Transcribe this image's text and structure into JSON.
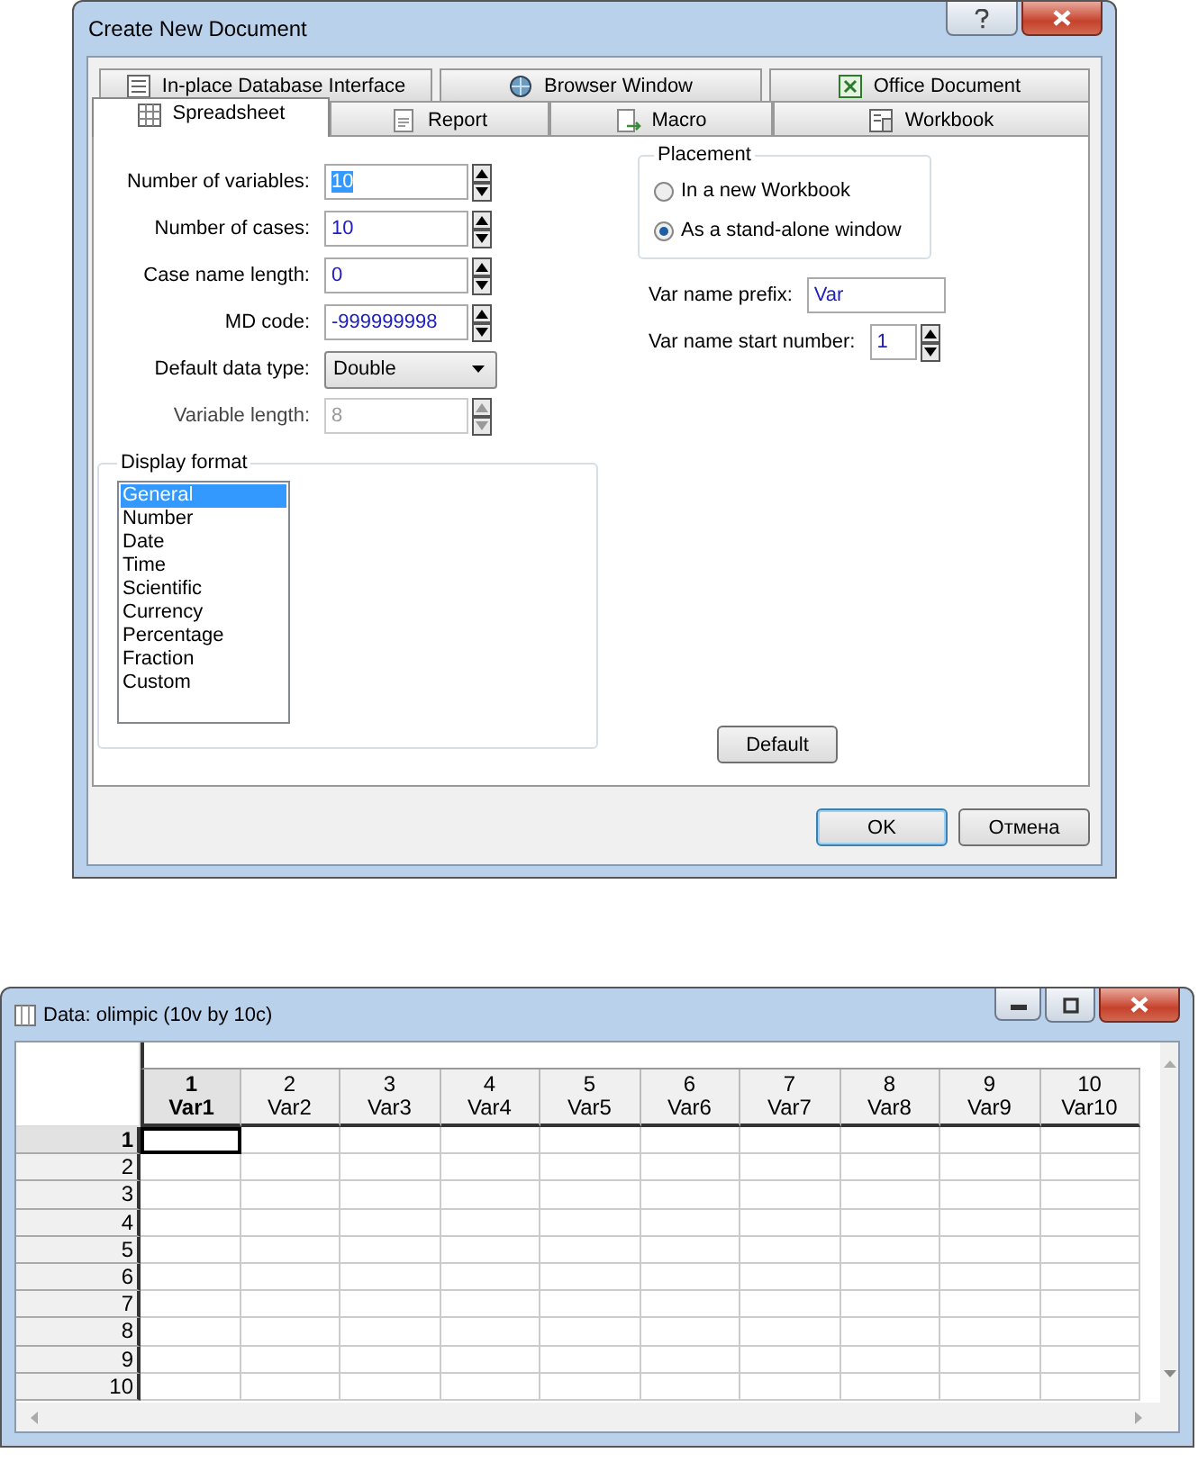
{
  "dialog": {
    "title": "Create New Document",
    "tabs_row_1": [
      {
        "label": "In-place Database Interface",
        "selected": false
      },
      {
        "label": "Browser Window",
        "selected": false
      },
      {
        "label": "Office Document",
        "selected": false
      }
    ],
    "tabs_row_2": [
      {
        "label": "Spreadsheet",
        "selected": true
      },
      {
        "label": "Report",
        "selected": false
      },
      {
        "label": "Macro",
        "selected": false
      },
      {
        "label": "Workbook",
        "selected": false
      }
    ],
    "fields": [
      {
        "kind": "spin",
        "label": "Number of variables:",
        "value": "10",
        "text_selected": true,
        "disabled": false
      },
      {
        "kind": "spin",
        "label": "Number of cases:",
        "value": "10",
        "text_selected": false,
        "disabled": false
      },
      {
        "kind": "spin",
        "label": "Case name length:",
        "value": "0",
        "text_selected": false,
        "disabled": false
      },
      {
        "kind": "spin",
        "label": "MD code:",
        "value": "-999999998",
        "text_selected": false,
        "disabled": false
      },
      {
        "kind": "dropdown",
        "label": "Default data type:",
        "value": "Double",
        "text_selected": false,
        "disabled": false
      },
      {
        "kind": "spin",
        "label": "Variable length:",
        "value": "8",
        "text_selected": false,
        "disabled": true
      }
    ],
    "placement": {
      "title": "Placement",
      "options": [
        {
          "label": "In a new Workbook",
          "selected": false
        },
        {
          "label": "As a stand-alone window",
          "selected": true
        }
      ]
    },
    "var_name_prefix": {
      "label": "Var name prefix:",
      "value": "Var"
    },
    "var_name_start_number": {
      "label": "Var name start number:",
      "value": "1"
    },
    "display_format": {
      "title": "Display format",
      "items": [
        {
          "label": "General",
          "selected": true
        },
        {
          "label": "Number",
          "selected": false
        },
        {
          "label": "Date",
          "selected": false
        },
        {
          "label": "Time",
          "selected": false
        },
        {
          "label": "Scientific",
          "selected": false
        },
        {
          "label": "Currency",
          "selected": false
        },
        {
          "label": "Percentage",
          "selected": false
        },
        {
          "label": "Fraction",
          "selected": false
        },
        {
          "label": "Custom",
          "selected": false
        }
      ]
    },
    "default_button": "Default",
    "buttons": [
      "OK",
      "Отмена"
    ]
  },
  "datasheet": {
    "title": "Data: olimpic (10v by 10c)",
    "columns": [
      {
        "number": "1",
        "name": "Var1",
        "selected": true
      },
      {
        "number": "2",
        "name": "Var2",
        "selected": false
      },
      {
        "number": "3",
        "name": "Var3",
        "selected": false
      },
      {
        "number": "4",
        "name": "Var4",
        "selected": false
      },
      {
        "number": "5",
        "name": "Var5",
        "selected": false
      },
      {
        "number": "6",
        "name": "Var6",
        "selected": false
      },
      {
        "number": "7",
        "name": "Var7",
        "selected": false
      },
      {
        "number": "8",
        "name": "Var8",
        "selected": false
      },
      {
        "number": "9",
        "name": "Var9",
        "selected": false
      },
      {
        "number": "10",
        "name": "Var10",
        "selected": false
      }
    ],
    "rows": [
      {
        "label": "1",
        "selected": true
      },
      {
        "label": "2",
        "selected": false
      },
      {
        "label": "3",
        "selected": false
      },
      {
        "label": "4",
        "selected": false
      },
      {
        "label": "5",
        "selected": false
      },
      {
        "label": "6",
        "selected": false
      },
      {
        "label": "7",
        "selected": false
      },
      {
        "label": "8",
        "selected": false
      },
      {
        "label": "9",
        "selected": false
      },
      {
        "label": "10",
        "selected": false
      }
    ]
  }
}
